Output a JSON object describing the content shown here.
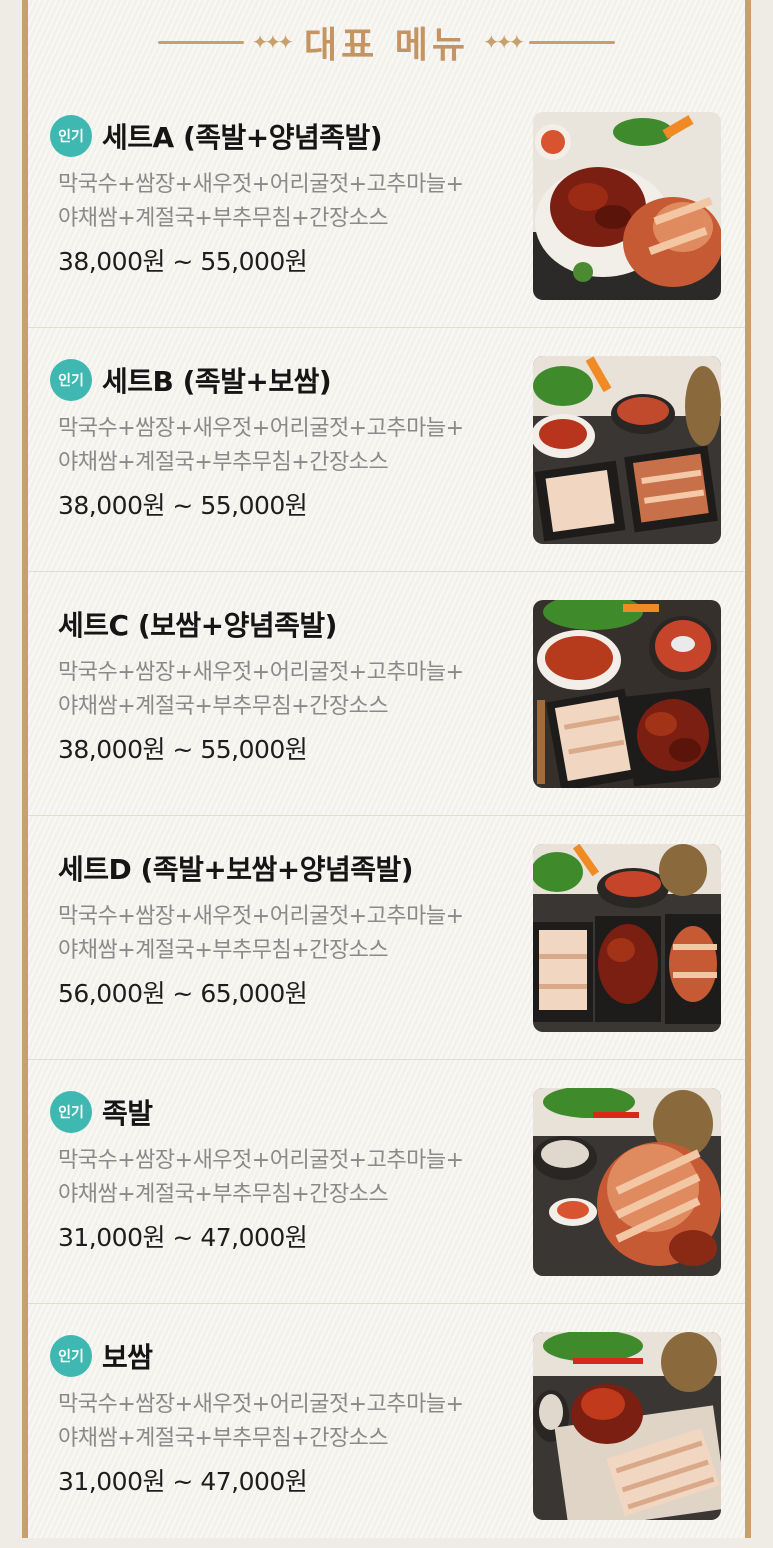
{
  "header": {
    "title": "대표 메뉴",
    "left_ornament": "✦✦✦",
    "right_ornament": "✦✦✦"
  },
  "colors": {
    "accent": "#c7a06e",
    "badge": "#3fb8b2",
    "price": "#1e1e1e",
    "desc": "#8a8a8a"
  },
  "menu": [
    {
      "badge": "인기",
      "name": "세트A (족발+양념족발)",
      "desc1": "막국수+쌈장+새우젓+어리굴젓+고추마늘+",
      "desc2": "야채쌈+계절국+부추무침+간장소스",
      "price": "38,000원 ~ 55,000원",
      "image_icon": "food-photo-set-a"
    },
    {
      "badge": "인기",
      "name": "세트B (족발+보쌈)",
      "desc1": "막국수+쌈장+새우젓+어리굴젓+고추마늘+",
      "desc2": "야채쌈+계절국+부추무침+간장소스",
      "price": "38,000원 ~ 55,000원",
      "image_icon": "food-photo-set-b"
    },
    {
      "badge": "",
      "name": "세트C (보쌈+양념족발)",
      "desc1": "막국수+쌈장+새우젓+어리굴젓+고추마늘+",
      "desc2": "야채쌈+계절국+부추무침+간장소스",
      "price": "38,000원 ~ 55,000원",
      "image_icon": "food-photo-set-c"
    },
    {
      "badge": "",
      "name": "세트D (족발+보쌈+양념족발)",
      "desc1": "막국수+쌈장+새우젓+어리굴젓+고추마늘+",
      "desc2": "야채쌈+계절국+부추무침+간장소스",
      "price": "56,000원 ~ 65,000원",
      "image_icon": "food-photo-set-d"
    },
    {
      "badge": "인기",
      "name": "족발",
      "desc1": "막국수+쌈장+새우젓+어리굴젓+고추마늘+",
      "desc2": "야채쌈+계절국+부추무침+간장소스",
      "price": "31,000원 ~ 47,000원",
      "image_icon": "food-photo-jokbal"
    },
    {
      "badge": "인기",
      "name": "보쌈",
      "desc1": "막국수+쌈장+새우젓+어리굴젓+고추마늘+",
      "desc2": "야채쌈+계절국+부추무침+간장소스",
      "price": "31,000원 ~ 47,000원",
      "image_icon": "food-photo-bossam"
    }
  ]
}
